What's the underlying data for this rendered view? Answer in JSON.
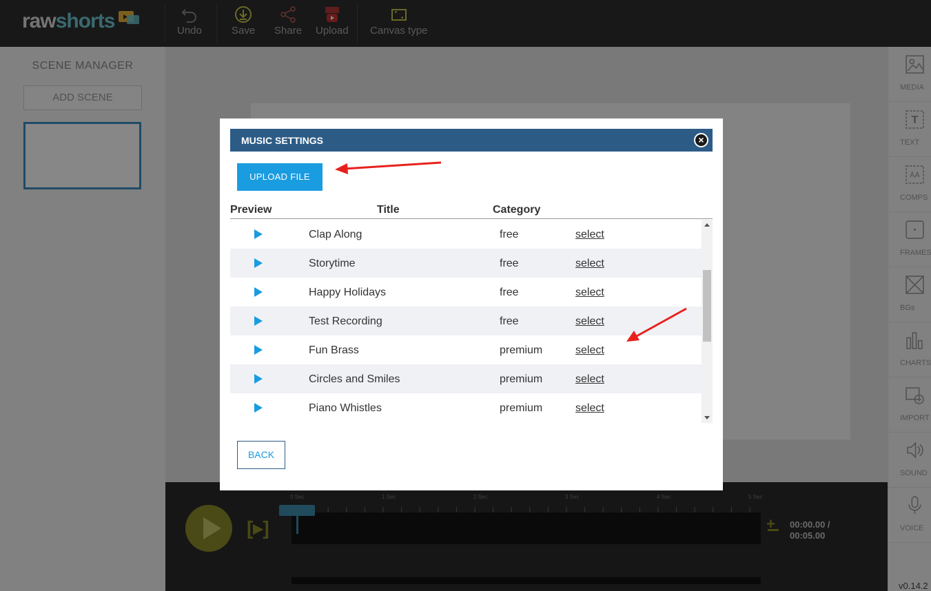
{
  "app": {
    "logo_raw": "raw",
    "logo_shorts": "shorts",
    "version": "v0.14.2"
  },
  "toolbar": {
    "undo": "Undo",
    "save": "Save",
    "share": "Share",
    "upload": "Upload",
    "canvas_type": "Canvas type"
  },
  "scene_manager": {
    "title": "SCENE MANAGER",
    "add_scene": "ADD SCENE"
  },
  "right_bar": {
    "items": [
      {
        "label": "MEDIA",
        "icon": "image-icon"
      },
      {
        "label": "TEXT",
        "icon": "text-icon"
      },
      {
        "label": "COMPS",
        "icon": "comps-icon"
      },
      {
        "label": "FRAMES",
        "icon": "frames-icon"
      },
      {
        "label": "BGs",
        "icon": "backgrounds-icon"
      },
      {
        "label": "CHARTS",
        "icon": "chart-icon"
      },
      {
        "label": "IMPORT",
        "icon": "import-icon"
      },
      {
        "label": "SOUND",
        "icon": "speaker-icon"
      },
      {
        "label": "VOICE",
        "icon": "microphone-icon"
      }
    ]
  },
  "timeline": {
    "ruler": [
      "0 Sec",
      "1 Sec",
      "2 Sec",
      "3 Sec",
      "4 Sec",
      "5 Sec"
    ],
    "current_time": "00:00.00 /",
    "total_time": "00:05.00",
    "accent_color": "#8c8c2a"
  },
  "modal": {
    "title": "MUSIC SETTINGS",
    "upload_button": "UPLOAD FILE",
    "back_button": "BACK",
    "columns": {
      "preview": "Preview",
      "title": "Title",
      "category": "Category"
    },
    "tracks": [
      {
        "title": "Clap Along",
        "category": "free",
        "action": "select"
      },
      {
        "title": "Storytime",
        "category": "free",
        "action": "select"
      },
      {
        "title": "Happy Holidays",
        "category": "free",
        "action": "select"
      },
      {
        "title": "Test Recording",
        "category": "free",
        "action": "select"
      },
      {
        "title": "Fun Brass",
        "category": "premium",
        "action": "select"
      },
      {
        "title": "Circles and Smiles",
        "category": "premium",
        "action": "select"
      },
      {
        "title": "Piano Whistles",
        "category": "premium",
        "action": "select"
      }
    ],
    "header_color": "#2c5c86",
    "accent_color": "#1a9ce0"
  }
}
